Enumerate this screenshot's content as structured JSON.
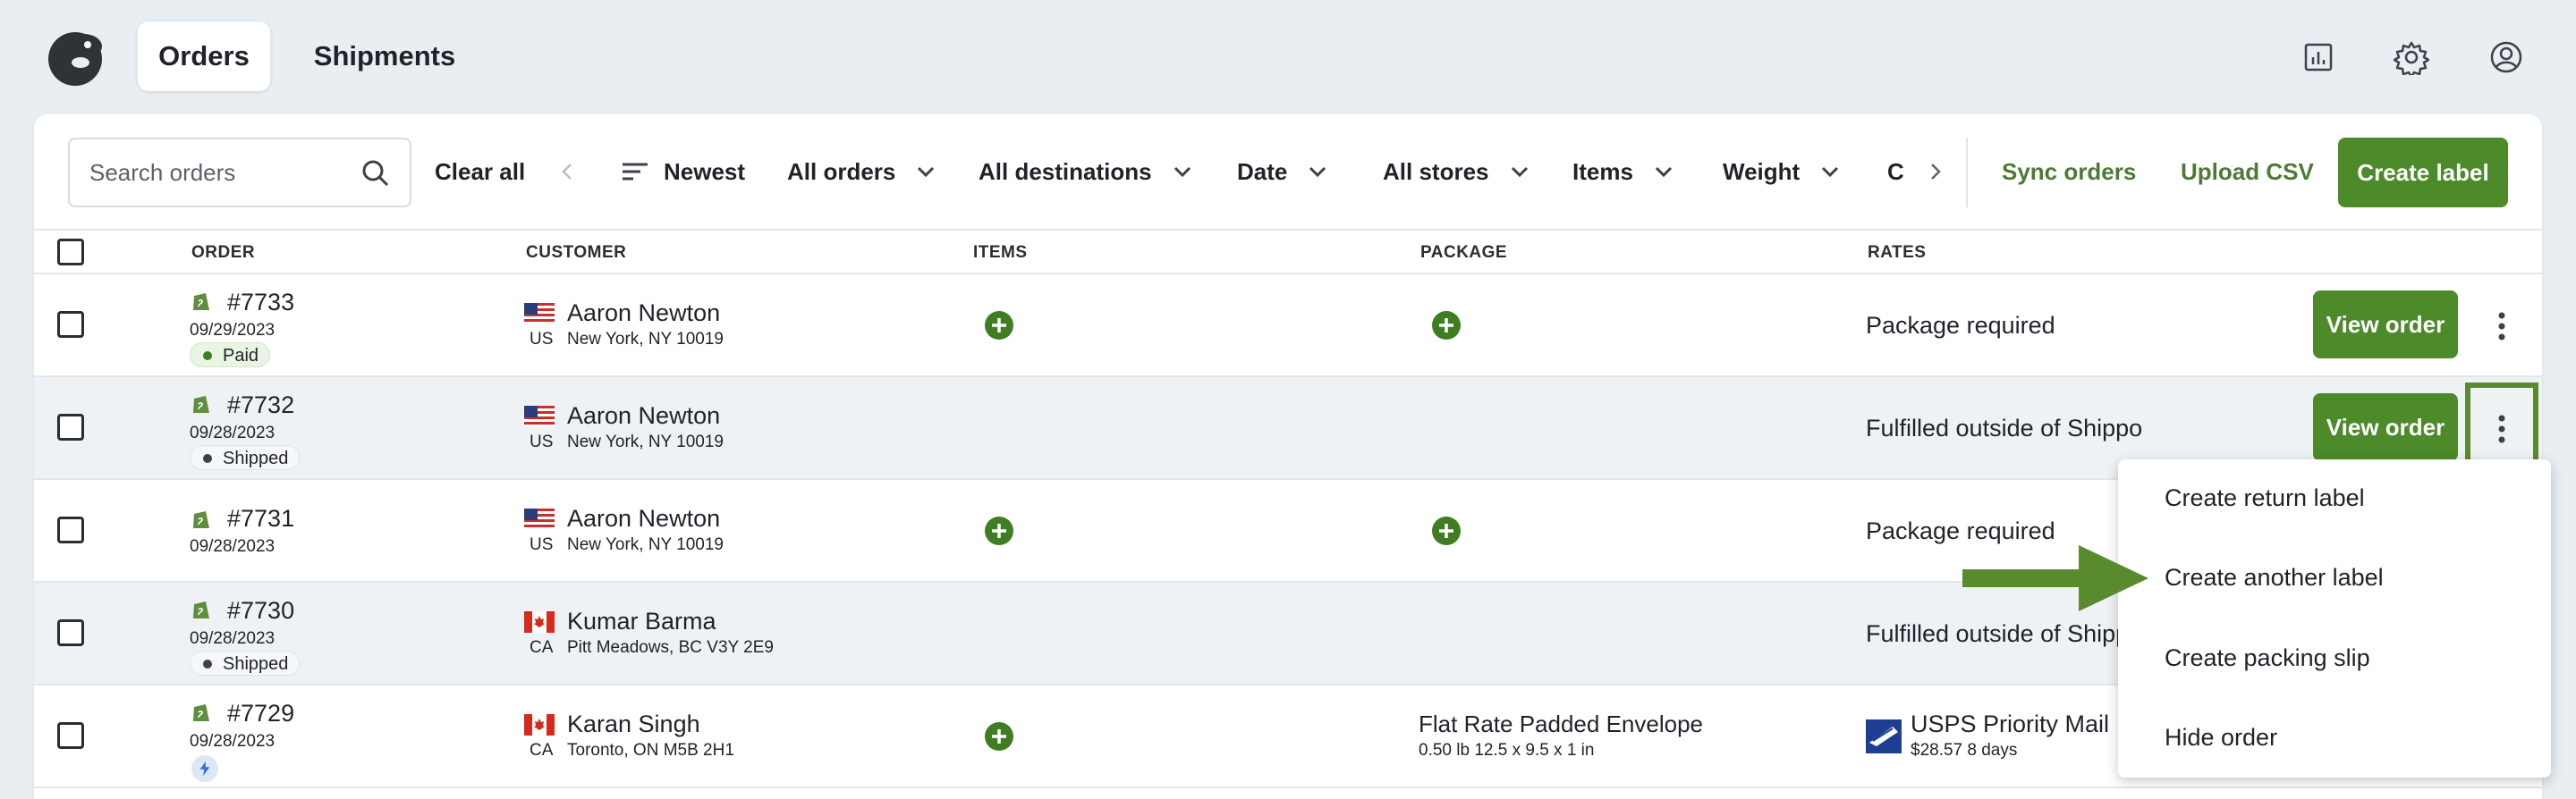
{
  "topbar": {
    "tabs": [
      {
        "label": "Orders",
        "active": true
      },
      {
        "label": "Shipments",
        "active": false
      }
    ],
    "icons": [
      "reports-icon",
      "gear-icon",
      "account-icon"
    ]
  },
  "toolbar": {
    "search_placeholder": "Search orders",
    "clear_all": "Clear all",
    "sort_label": "Newest",
    "filters": [
      "All orders",
      "All destinations",
      "Date",
      "All stores",
      "Items",
      "Weight",
      "C"
    ],
    "sync_orders": "Sync orders",
    "upload_csv": "Upload CSV",
    "create_label": "Create label"
  },
  "table": {
    "columns": [
      "ORDER",
      "CUSTOMER",
      "ITEMS",
      "PACKAGE",
      "RATES"
    ],
    "rows": [
      {
        "order": "#7733",
        "date": "09/29/2023",
        "status": "Paid",
        "country": "US",
        "name": "Aaron Newton",
        "address": "New York, NY 10019",
        "items_add": true,
        "package_add": true,
        "rate": "Package required",
        "button": "View order"
      },
      {
        "order": "#7732",
        "date": "09/28/2023",
        "status": "Shipped",
        "country": "US",
        "name": "Aaron Newton",
        "address": "New York, NY 10019",
        "items_add": false,
        "package_add": false,
        "rate": "Fulfilled outside of Shippo",
        "button": "View order"
      },
      {
        "order": "#7731",
        "date": "09/28/2023",
        "status": "",
        "country": "US",
        "name": "Aaron Newton",
        "address": "New York, NY 10019",
        "items_add": true,
        "package_add": true,
        "rate": "Package required"
      },
      {
        "order": "#7730",
        "date": "09/28/2023",
        "status": "Shipped",
        "country": "CA",
        "name": "Kumar Barma",
        "address": "Pitt Meadows, BC V3Y 2E9",
        "items_add": false,
        "package_add": false,
        "rate": "Fulfilled outside of Shippo"
      },
      {
        "order": "#7729",
        "date": "09/28/2023",
        "status": "",
        "country": "CA",
        "name": "Karan Singh",
        "address": "Toronto, ON M5B 2H1",
        "items_add": true,
        "package_name": "Flat Rate Padded Envelope",
        "package_detail": "0.50 lb 12.5 x 9.5 x 1 in",
        "rate_name": "USPS Priority Mail In",
        "rate_detail": "$28.57 8 days"
      }
    ]
  },
  "menu": {
    "items": [
      "Create return label",
      "Create another label",
      "Create packing slip",
      "Hide order"
    ]
  },
  "colors": {
    "accent_green": "#4c8a2a",
    "highlight_green": "#5a8a2e",
    "background": "#e9eef2"
  }
}
